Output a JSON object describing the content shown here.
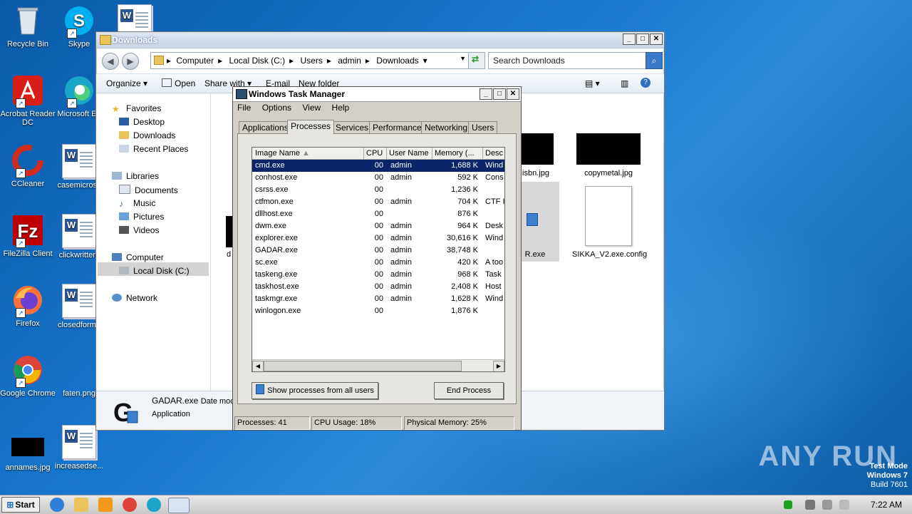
{
  "desktop": {
    "icons": [
      {
        "label": "Recycle Bin"
      },
      {
        "label": "Skype"
      },
      {
        "label": "Acrobat Reader DC"
      },
      {
        "label": "Microsoft Ed"
      },
      {
        "label": "CCleaner"
      },
      {
        "label": "casemicrosc"
      },
      {
        "label": "FileZilla Client"
      },
      {
        "label": "clickwritten."
      },
      {
        "label": "Firefox"
      },
      {
        "label": "closedforma"
      },
      {
        "label": "Google Chrome"
      },
      {
        "label": "faten.png"
      },
      {
        "label": "annames.jpg"
      },
      {
        "label": "increasedse..."
      }
    ],
    "watermark": "ANY RUN",
    "test_mode": [
      "Test Mode",
      "Windows 7",
      "Build 7601"
    ]
  },
  "explorer": {
    "title": "Downloads",
    "breadcrumbs": [
      "Computer",
      "Local Disk (C:)",
      "Users",
      "admin",
      "Downloads"
    ],
    "search_placeholder": "Search Downloads",
    "toolbar": {
      "organize": "Organize",
      "open": "Open",
      "share": "Share with",
      "email": "E-mail",
      "new_folder": "New folder"
    },
    "nav": {
      "favorites": "Favorites",
      "desktop": "Desktop",
      "downloads": "Downloads",
      "recent": "Recent Places",
      "libraries": "Libraries",
      "documents": "Documents",
      "music": "Music",
      "pictures": "Pictures",
      "videos": "Videos",
      "computer": "Computer",
      "local_disk": "Local Disk (C:)",
      "network": "Network"
    },
    "files": {
      "isbn": "isbn.jpg",
      "copymetal": "copymetal.jpg",
      "gadar_partial": "R.exe",
      "sikka": "SIKKA_V2.exe.config",
      "d_partial": "d"
    },
    "details": {
      "name": "GADAR.exe",
      "date_label": "Date mod",
      "type": "Application"
    }
  },
  "taskmgr": {
    "title": "Windows Task Manager",
    "menu": [
      "File",
      "Options",
      "View",
      "Help"
    ],
    "tabs": [
      "Applications",
      "Processes",
      "Services",
      "Performance",
      "Networking",
      "Users"
    ],
    "columns": [
      "Image Name",
      "CPU",
      "User Name",
      "Memory (...",
      "Desc"
    ],
    "rows": [
      {
        "name": "cmd.exe",
        "cpu": "00",
        "user": "admin",
        "mem": "1,688 K",
        "desc": "Wind"
      },
      {
        "name": "conhost.exe",
        "cpu": "00",
        "user": "admin",
        "mem": "592 K",
        "desc": "Cons"
      },
      {
        "name": "csrss.exe",
        "cpu": "00",
        "user": "",
        "mem": "1,236 K",
        "desc": ""
      },
      {
        "name": "ctfmon.exe",
        "cpu": "00",
        "user": "admin",
        "mem": "704 K",
        "desc": "CTF I"
      },
      {
        "name": "dllhost.exe",
        "cpu": "00",
        "user": "",
        "mem": "876 K",
        "desc": ""
      },
      {
        "name": "dwm.exe",
        "cpu": "00",
        "user": "admin",
        "mem": "964 K",
        "desc": "Desk"
      },
      {
        "name": "explorer.exe",
        "cpu": "00",
        "user": "admin",
        "mem": "30,616 K",
        "desc": "Wind"
      },
      {
        "name": "GADAR.exe",
        "cpu": "00",
        "user": "admin",
        "mem": "38,748 K",
        "desc": ""
      },
      {
        "name": "sc.exe",
        "cpu": "00",
        "user": "admin",
        "mem": "420 K",
        "desc": "A too"
      },
      {
        "name": "taskeng.exe",
        "cpu": "00",
        "user": "admin",
        "mem": "968 K",
        "desc": "Task"
      },
      {
        "name": "taskhost.exe",
        "cpu": "00",
        "user": "admin",
        "mem": "2,408 K",
        "desc": "Host"
      },
      {
        "name": "taskmgr.exe",
        "cpu": "00",
        "user": "admin",
        "mem": "1,628 K",
        "desc": "Wind"
      },
      {
        "name": "winlogon.exe",
        "cpu": "00",
        "user": "",
        "mem": "1,876 K",
        "desc": ""
      }
    ],
    "show_all_button": "Show processes from all users",
    "end_process_button": "End Process",
    "status": {
      "processes": "Processes: 41",
      "cpu": "CPU Usage: 18%",
      "memory": "Physical Memory: 25%"
    }
  },
  "taskbar": {
    "start": "Start",
    "clock": "7:22 AM"
  }
}
